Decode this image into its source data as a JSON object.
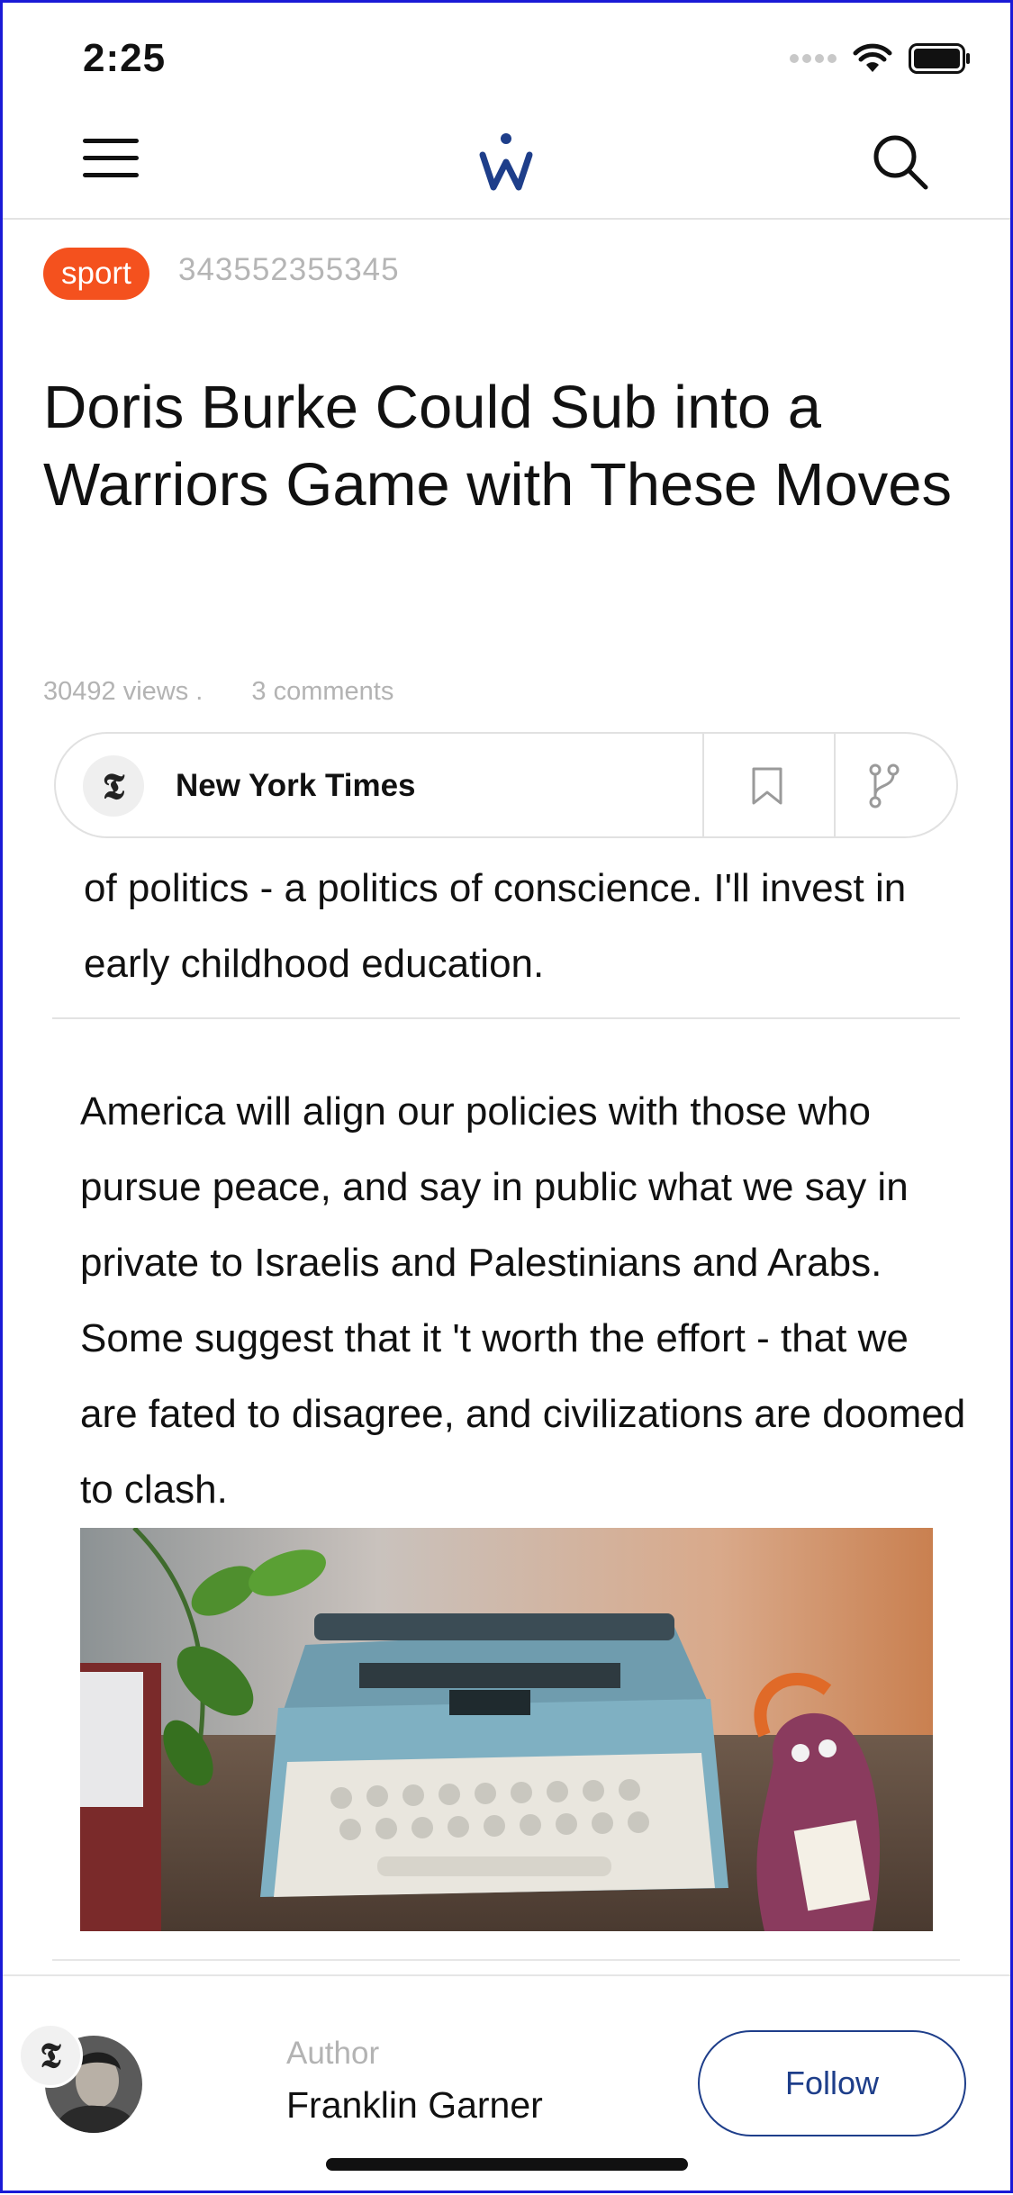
{
  "status_bar": {
    "time": "2:25"
  },
  "nav": {
    "logo_icon": "w-logo-icon",
    "menu_icon": "hamburger-icon",
    "search_icon": "search-icon"
  },
  "article": {
    "category": "sport",
    "post_id": "343552355345",
    "title": "Doris Burke Could Sub into a Warriors Game with These Moves",
    "views": "30492 views .",
    "comments": "3 comments",
    "source": {
      "name": "New York Times",
      "avatar_glyph": "𝕿"
    },
    "paragraph_1": "of politics - a politics of conscience. I'll invest in early childhood education.",
    "paragraph_2": "America will align our policies with those who pursue peace, and say in public what we say in private to Israelis and Palestinians and Arabs. Some suggest that it 't worth the effort - that we are fated to disagree, and civilizations are doomed to clash."
  },
  "author": {
    "label": "Author",
    "name": "Franklin Garner",
    "badge_glyph": "𝕿",
    "follow_label": "Follow"
  },
  "colors": {
    "category_bg": "#f4511e",
    "brand_blue": "#1e3e8a"
  }
}
